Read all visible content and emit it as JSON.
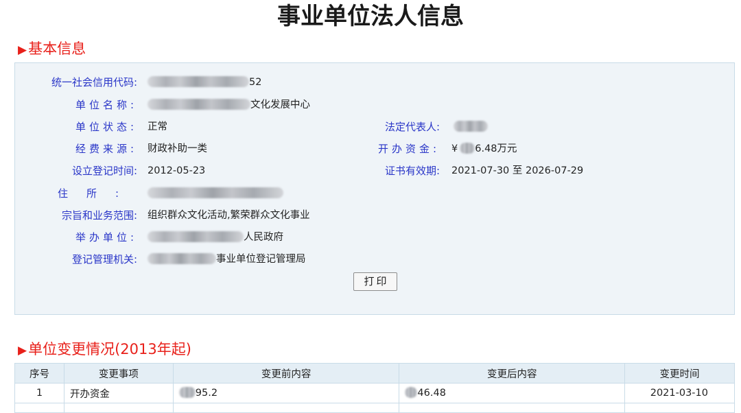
{
  "page": {
    "title": "事业单位法人信息"
  },
  "sections": {
    "basic_info": "基本信息",
    "changes": "单位变更情况(2013年起)"
  },
  "basic_info": {
    "credit_code": {
      "label": "统一社会信用代码:",
      "value_visible": "52"
    },
    "unit_name": {
      "label": "单位名称:",
      "value_visible": "文化发展中心"
    },
    "unit_status": {
      "label": "单位状态:",
      "value": "正常"
    },
    "legal_rep": {
      "label": "法定代表人:"
    },
    "funding_source": {
      "label": "经费来源:",
      "value": "财政补助一类"
    },
    "capital": {
      "label": "开办资金:",
      "prefix": "¥",
      "value_visible": "6.48万元"
    },
    "reg_date": {
      "label": "设立登记时间:",
      "value": "2012-05-23"
    },
    "cert_validity": {
      "label": "证书有效期:",
      "value": "2021-07-30 至 2026-07-29"
    },
    "address": {
      "label": "住所:"
    },
    "scope": {
      "label": "宗旨和业务范围:",
      "value": "组织群众文化活动,繁荣群众文化事业"
    },
    "sponsor": {
      "label": "举办单位:",
      "value_visible": "人民政府"
    },
    "authority": {
      "label": "登记管理机关:",
      "value_visible": "事业单位登记管理局"
    }
  },
  "print_button": "打印",
  "changes_table": {
    "columns": [
      "序号",
      "变更事项",
      "变更前内容",
      "变更后内容",
      "变更时间"
    ],
    "rows": [
      {
        "index": "1",
        "item": "开办资金",
        "before": "95.2",
        "after": "46.48",
        "date": "2021-03-10"
      }
    ]
  },
  "colors": {
    "accent_red": "#e8201a",
    "label_blue": "#2a36c8",
    "panel_bg": "#eff4f8"
  }
}
